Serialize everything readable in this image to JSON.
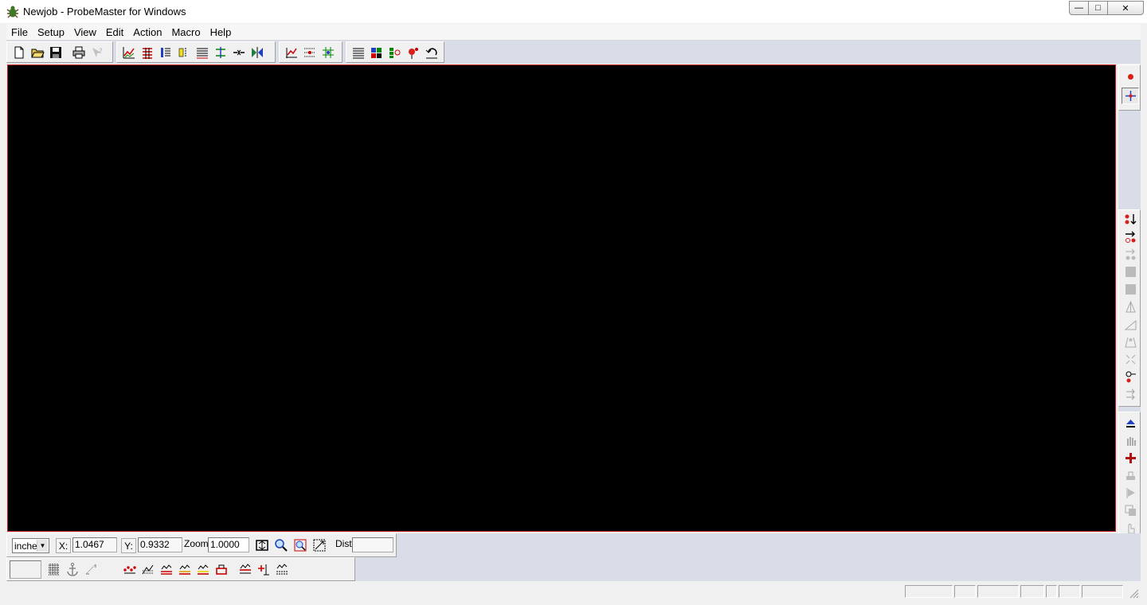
{
  "window": {
    "title": "Newjob - ProbeMaster for Windows",
    "controls": {
      "minimize": "—",
      "maximize": "□",
      "close": "✕"
    }
  },
  "menu": {
    "items": [
      "File",
      "Setup",
      "View",
      "Edit",
      "Action",
      "Macro",
      "Help"
    ]
  },
  "toolbar": {
    "groups": [
      [
        "new-document-icon",
        "open-folder-icon",
        "save-disk-icon",
        "print-icon",
        "context-help-icon"
      ],
      [
        "wave-graph-icon",
        "red-grid-icon",
        "bar-list-icon",
        "yellow-marker-icon",
        "hatch-pattern-icon",
        "cross-arrows-icon",
        "merge-arrows-icon",
        "mirror-icon"
      ],
      [
        "red-arrow-graph-icon",
        "dot-pattern-icon",
        "green-network-icon"
      ],
      [
        "parallel-lines-icon",
        "color-blocks-icon",
        "green-square-icon",
        "red-pin-icon",
        "undo-loop-icon"
      ]
    ]
  },
  "canvas": {
    "background": "#000000",
    "border": "#c81e1e"
  },
  "side_toolbar": {
    "top": [
      "red-dot-icon",
      "crosshair-icon"
    ],
    "middle": [
      "red-dot-down-arrow-icon",
      "arrow-right-dots-icon",
      "dots-arrow-icon",
      "gray-square-icon",
      "gray-square-icon",
      "triangle-outline-icon",
      "wedge-icon",
      "cone-icon",
      "scatter-arrows-icon",
      "lasso-dot-icon",
      "parallel-arrows-icon"
    ],
    "bottom": [
      "eject-icon",
      "hand-icon",
      "red-plus-icon",
      "stamp-icon",
      "play-flag-icon",
      "copy-block-icon",
      "hand-pointer-icon"
    ]
  },
  "coords": {
    "unit": "inche",
    "x_label": "X:",
    "x_value": "1.0467",
    "y_label": "Y:",
    "y_value": "0.9332",
    "zoom_label": "Zoom",
    "zoom_value": "1.0000",
    "dist_label": "Dist",
    "dist_value": ""
  },
  "coord_tools": [
    "fit-view-icon",
    "zoom-magnifier-icon",
    "zoom-region-icon",
    "zoom-box-icon"
  ],
  "bottom_toolbar": {
    "left": [
      "grid-dots-icon",
      "anchor-icon",
      "diagonal-dots-icon"
    ],
    "middle": [
      "red-dots-graph-icon",
      "hatch-graph-icon",
      "red-underline-icon",
      "orange-underline-icon",
      "yellow-underline-icon",
      "red-box-icon"
    ],
    "right": [
      "red-cross-graph-icon",
      "add-node-icon",
      "dashed-graph-icon"
    ]
  },
  "colors": {
    "accent_red": "#d8201b",
    "toolbar_bg": "#d9dde8",
    "chrome": "#f0f0f0"
  }
}
